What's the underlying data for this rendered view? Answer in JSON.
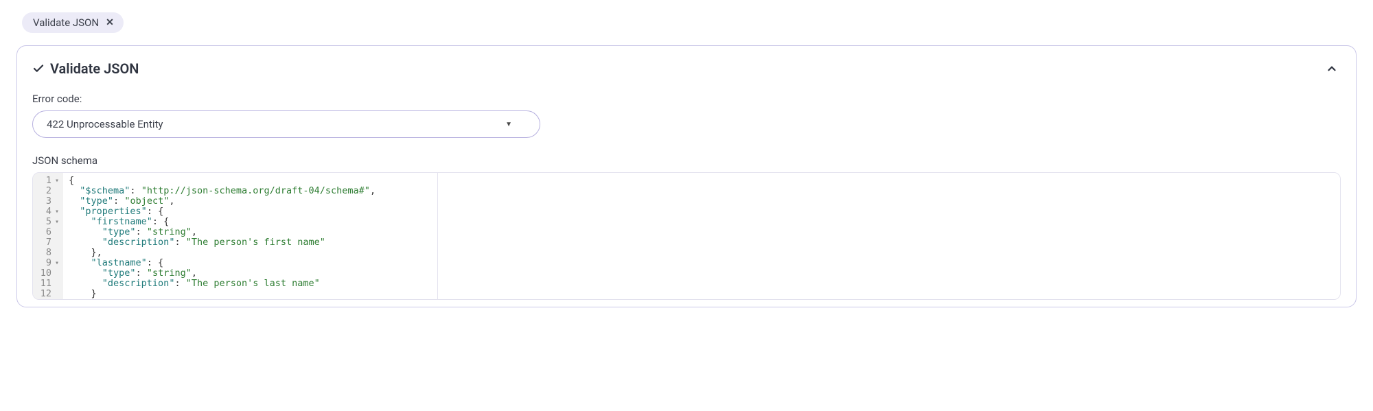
{
  "chip": {
    "label": "Validate JSON"
  },
  "panel": {
    "title": "Validate JSON",
    "error_code_label": "Error code:",
    "error_code_value": "422 Unprocessable Entity",
    "schema_label": "JSON schema"
  },
  "code": {
    "lines": [
      {
        "n": "1",
        "fold": true,
        "indent": 0,
        "segments": [
          {
            "t": "{",
            "c": "punc"
          }
        ]
      },
      {
        "n": "2",
        "fold": false,
        "indent": 1,
        "segments": [
          {
            "t": "\"$schema\"",
            "c": "key"
          },
          {
            "t": ": ",
            "c": "punc"
          },
          {
            "t": "\"http://json-schema.org/draft-04/schema#\"",
            "c": "str"
          },
          {
            "t": ",",
            "c": "punc"
          }
        ]
      },
      {
        "n": "3",
        "fold": false,
        "indent": 1,
        "segments": [
          {
            "t": "\"type\"",
            "c": "key"
          },
          {
            "t": ": ",
            "c": "punc"
          },
          {
            "t": "\"object\"",
            "c": "str"
          },
          {
            "t": ",",
            "c": "punc"
          }
        ]
      },
      {
        "n": "4",
        "fold": true,
        "indent": 1,
        "segments": [
          {
            "t": "\"properties\"",
            "c": "key"
          },
          {
            "t": ": {",
            "c": "punc"
          }
        ]
      },
      {
        "n": "5",
        "fold": true,
        "indent": 2,
        "segments": [
          {
            "t": "\"firstname\"",
            "c": "key"
          },
          {
            "t": ": {",
            "c": "punc"
          }
        ]
      },
      {
        "n": "6",
        "fold": false,
        "indent": 3,
        "segments": [
          {
            "t": "\"type\"",
            "c": "key"
          },
          {
            "t": ": ",
            "c": "punc"
          },
          {
            "t": "\"string\"",
            "c": "str"
          },
          {
            "t": ",",
            "c": "punc"
          }
        ]
      },
      {
        "n": "7",
        "fold": false,
        "indent": 3,
        "segments": [
          {
            "t": "\"description\"",
            "c": "key"
          },
          {
            "t": ": ",
            "c": "punc"
          },
          {
            "t": "\"The person's first name\"",
            "c": "str"
          }
        ]
      },
      {
        "n": "8",
        "fold": false,
        "indent": 2,
        "segments": [
          {
            "t": "},",
            "c": "punc"
          }
        ]
      },
      {
        "n": "9",
        "fold": true,
        "indent": 2,
        "segments": [
          {
            "t": "\"lastname\"",
            "c": "key"
          },
          {
            "t": ": {",
            "c": "punc"
          }
        ]
      },
      {
        "n": "10",
        "fold": false,
        "indent": 3,
        "segments": [
          {
            "t": "\"type\"",
            "c": "key"
          },
          {
            "t": ": ",
            "c": "punc"
          },
          {
            "t": "\"string\"",
            "c": "str"
          },
          {
            "t": ",",
            "c": "punc"
          }
        ]
      },
      {
        "n": "11",
        "fold": false,
        "indent": 3,
        "segments": [
          {
            "t": "\"description\"",
            "c": "key"
          },
          {
            "t": ": ",
            "c": "punc"
          },
          {
            "t": "\"The person's last name\"",
            "c": "str"
          }
        ]
      },
      {
        "n": "12",
        "fold": false,
        "indent": 2,
        "segments": [
          {
            "t": "}",
            "c": "punc"
          }
        ]
      }
    ]
  }
}
